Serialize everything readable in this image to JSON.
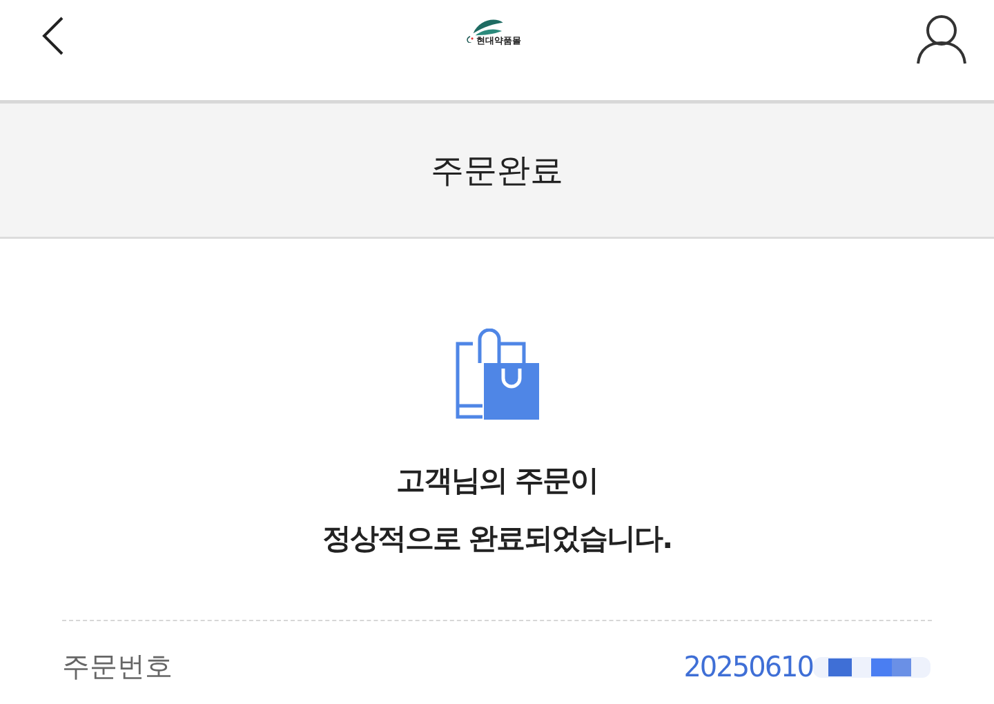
{
  "header": {
    "logo_text": "현대약품몰"
  },
  "title": "주문완료",
  "message": [
    "고객님의 주문이",
    "정상적으로 완료되었습니다."
  ],
  "order": {
    "label": "주문번호",
    "number": "20250610"
  }
}
